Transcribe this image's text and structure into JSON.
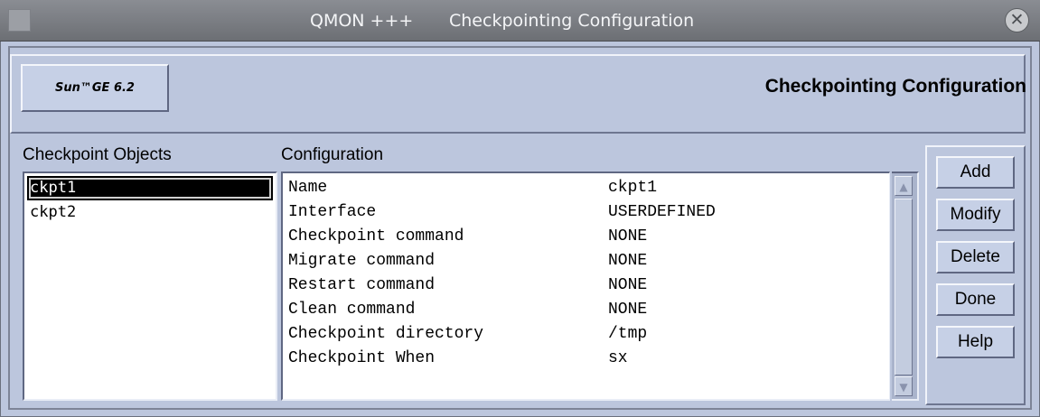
{
  "window": {
    "app_title": "QMON +++",
    "title": "Checkpointing Configuration",
    "close_glyph": "✕"
  },
  "header": {
    "logo_text": "Sun™GE 6.2",
    "title": "Checkpointing Configuration"
  },
  "objects": {
    "label": "Checkpoint Objects",
    "items": [
      "ckpt1",
      "ckpt2"
    ],
    "selected": "ckpt1"
  },
  "configuration": {
    "label": "Configuration",
    "rows": [
      {
        "key": "Name",
        "value": "ckpt1"
      },
      {
        "key": "Interface",
        "value": "USERDEFINED"
      },
      {
        "key": "Checkpoint command",
        "value": "NONE"
      },
      {
        "key": "Migrate command",
        "value": "NONE"
      },
      {
        "key": "Restart command",
        "value": "NONE"
      },
      {
        "key": "Clean command",
        "value": "NONE"
      },
      {
        "key": "Checkpoint directory",
        "value": "/tmp"
      },
      {
        "key": "Checkpoint When",
        "value": "sx"
      }
    ]
  },
  "buttons": {
    "add": "Add",
    "modify": "Modify",
    "delete": "Delete",
    "done": "Done",
    "help": "Help"
  },
  "colors": {
    "titlebar": "#7b7e84",
    "panel": "#bcc6dd",
    "selection": "#000000"
  },
  "icons": {
    "window_menu": "window-menu-icon",
    "close": "close-icon",
    "scroll_up": "arrow-up-icon",
    "scroll_down": "arrow-down-icon"
  }
}
